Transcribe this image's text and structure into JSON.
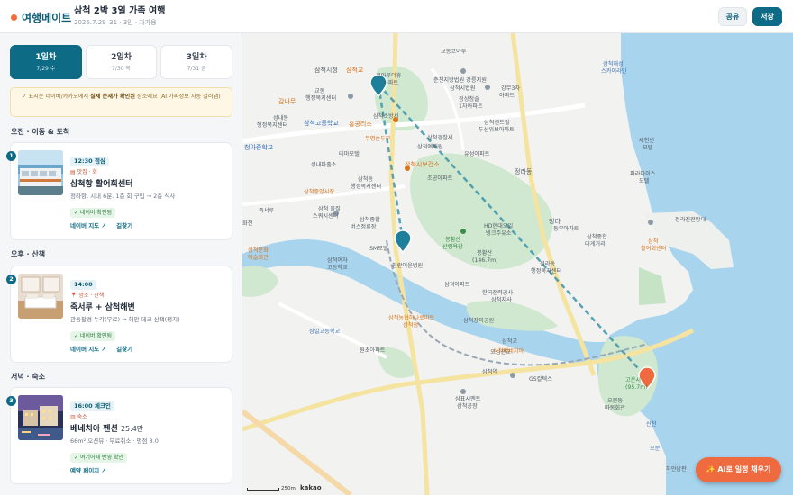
{
  "header": {
    "brand": "여행메이트",
    "trip_title": "삼척 2박 3일 가족 여행",
    "trip_meta": "2026.7.29–31 · 3인 · 자가용",
    "share_label": "공유",
    "save_label": "저장"
  },
  "colors": {
    "accent": "#0e6b86",
    "brand": "#f26b3a",
    "cta": "#ef6a3e"
  },
  "tabs": [
    {
      "day": "1일차",
      "date": "7/29 수",
      "active": true
    },
    {
      "day": "2일차",
      "date": "7/30 목",
      "active": false
    },
    {
      "day": "3일차",
      "date": "7/31 금",
      "active": false
    }
  ],
  "notice": {
    "pre": "✓ 표시는 네이버/카카오에서 ",
    "bold": "실제 존재가 확인된",
    "post": " 장소예요 (AI 가짜정보 자동 걸러냄)"
  },
  "sections": [
    {
      "label": "오전 · 이동 & 도착",
      "item": {
        "number": "1",
        "time": "12:30 점심",
        "category": "맛집 · 회",
        "name": "삼척항 활어회센터",
        "price": "",
        "desc": "정라항, 시내 6분. 1층 회 구입 → 2층 식사",
        "verified": "✓ 네이버 확인됨",
        "links": [
          "네이버 지도 ↗",
          "길찾기"
        ]
      }
    },
    {
      "label": "오후 · 산책",
      "item": {
        "number": "2",
        "time": "14:00",
        "category": "명소 · 산책",
        "name": "죽서루 + 삼척해변",
        "price": "",
        "desc": "관동팔경 누각(무료) → 해안 데크 산책(평지)",
        "verified": "✓ 네이버 확인됨",
        "links": [
          "네이버 지도 ↗",
          "길찾기"
        ]
      }
    },
    {
      "label": "저녁 · 숙소",
      "item": {
        "number": "3",
        "time": "16:00 체크인",
        "category": "숙소",
        "name": "베네치아 펜션",
        "price": "25.4만",
        "desc": "66m² 오션뷰 · 무료취소 · 평점 8.0",
        "verified": "✓ 여기어때 반영 확인",
        "links": [
          "예약 페이지 ↗"
        ]
      }
    }
  ],
  "map": {
    "scale": "250m",
    "provider": "kakao",
    "labels": [
      "삼척시청",
      "삼척교",
      "코아루더휴",
      "아파트",
      "교동코아루",
      "춘천지방법원 강릉지원",
      "삼척시법원",
      "강무3차",
      "아파트",
      "정상청솔",
      "1차아파트",
      "감나무",
      "교동",
      "행정복지센터",
      "성내동",
      "행정복지센터",
      "삼척고등학교",
      "삼척소방서",
      "홍콩리스",
      "무명순두부",
      "삼척경찰서",
      "삼척센트럴",
      "두산위브아파트",
      "청아중학교",
      "테마모텔",
      "삼척예배원",
      "삼척시보건소",
      "유성아파트",
      "성내파출소",
      "삼척동",
      "행정복지센터",
      "삼척중앙시장",
      "조공아파트",
      "정라동",
      "죽서루",
      "삼척 물질",
      "스쿼시센터",
      "삼척종합",
      "버스정류장",
      "HD현대오일",
      "뱅크주유소",
      "청라",
      "동부아파트",
      "봉황산",
      "산림욕장",
      "봉황산",
      "(146.7m)",
      "SM모텔",
      "천란이운병원",
      "정라동",
      "행정복지센터",
      "삼척종합",
      "대게거리",
      "삼척",
      "활어회센터",
      "정라진전망대",
      "삼척여자",
      "고등학교",
      "삼척아파트",
      "삼척농협하나로마트",
      "삼척점",
      "한국전력공사",
      "삼척지사",
      "삼척장미공원",
      "삼일고등학교",
      "원초아파트",
      "삼척교",
      "오십천교",
      "삼척베네치아",
      "삼척역",
      "GS칼텍스",
      "고운시",
      "(95.7m)",
      "삼표시멘트",
      "삼척공장",
      "오분동",
      "마동회관",
      "신천",
      "오분",
      "하얀남판",
      "삼척해성",
      "스카이라인",
      "파라다이스",
      "모텔",
      "새천년",
      "모텔",
      "화전",
      "삼척문화",
      "예술회관"
    ]
  },
  "ai_button": "✨ AI로 일정 채우기"
}
